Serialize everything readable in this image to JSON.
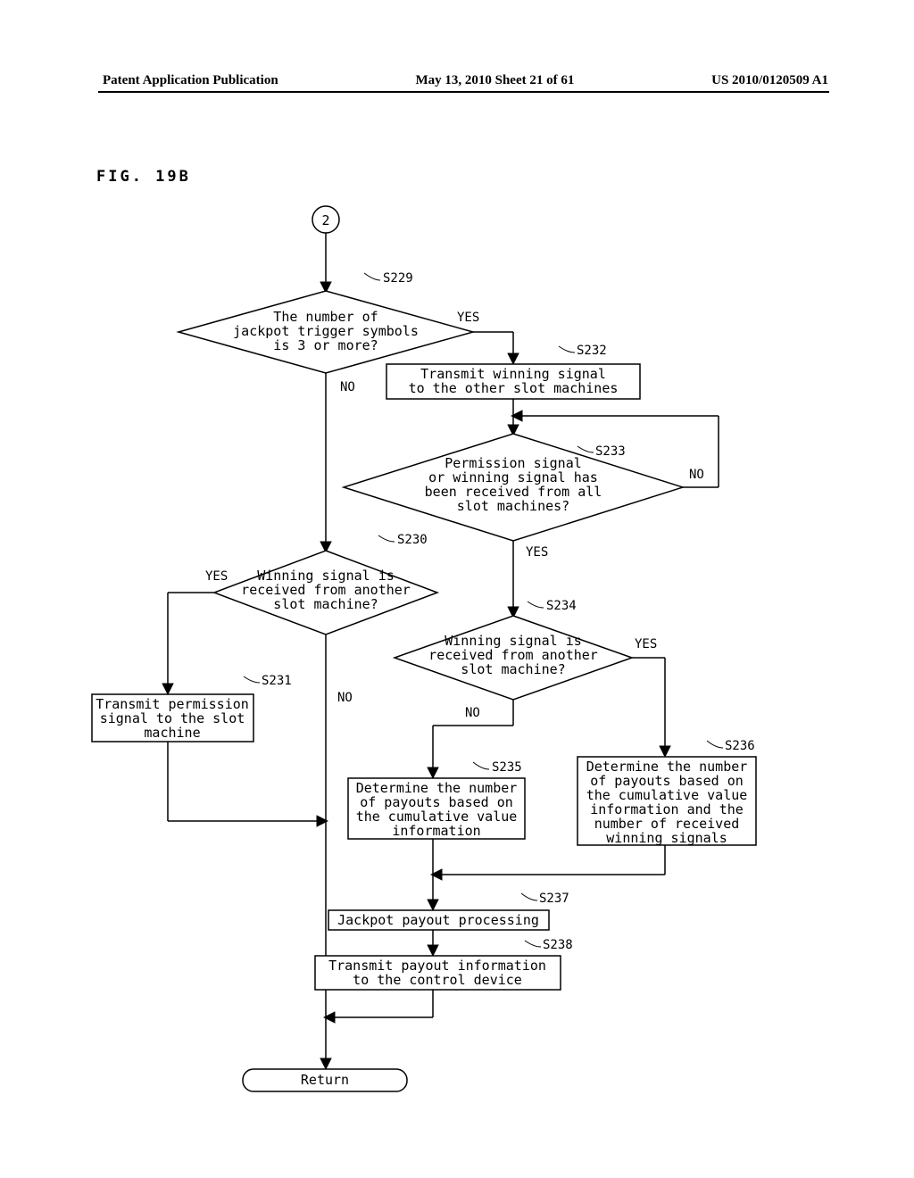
{
  "header": {
    "left": "Patent Application Publication",
    "center": "May 13, 2010  Sheet 21 of 61",
    "right": "US 2010/0120509 A1"
  },
  "figure_label": "FIG. 19B",
  "connector_label": "2",
  "steps": {
    "S229": {
      "ref": "S229",
      "text": "The number of\njackpot trigger symbols\nis 3 or more?",
      "yes": "YES",
      "no": "NO"
    },
    "S230": {
      "ref": "S230",
      "text": "Winning signal is\nreceived from another\nslot machine?",
      "yes": "YES",
      "no": "NO"
    },
    "S231": {
      "ref": "S231",
      "text": "Transmit permission\nsignal to the slot\nmachine"
    },
    "S232": {
      "ref": "S232",
      "text": "Transmit winning signal\nto the other slot machines"
    },
    "S233": {
      "ref": "S233",
      "text": "Permission signal\nor winning signal has\nbeen received from all\nslot machines?",
      "yes": "YES",
      "no": "NO"
    },
    "S234": {
      "ref": "S234",
      "text": "Winning signal is\nreceived from another\nslot machine?",
      "yes": "YES",
      "no": "NO"
    },
    "S235": {
      "ref": "S235",
      "text": "Determine the number\nof payouts based on\nthe cumulative value\ninformation"
    },
    "S236": {
      "ref": "S236",
      "text": "Determine the number\nof payouts based on\nthe cumulative value\ninformation and the\nnumber of received\nwinning signals"
    },
    "S237": {
      "ref": "S237",
      "text": "Jackpot payout processing"
    },
    "S238": {
      "ref": "S238",
      "text": "Transmit payout information\nto the control device"
    },
    "return": {
      "text": "Return"
    }
  }
}
